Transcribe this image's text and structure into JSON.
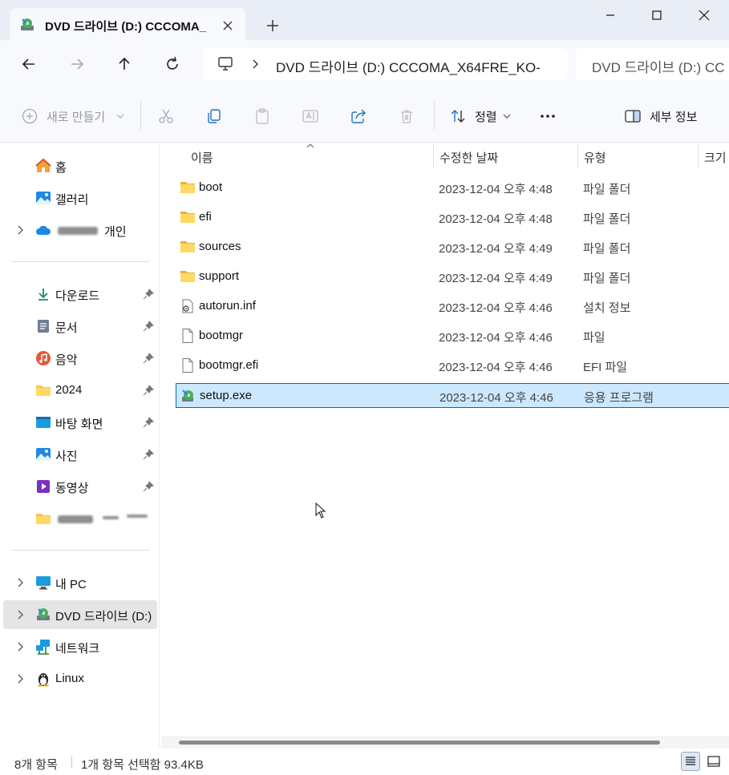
{
  "window": {
    "tab_title": "DVD 드라이브 (D:) CCCOMA_",
    "controls": [
      "minimize",
      "maximize",
      "close"
    ]
  },
  "address": {
    "path": "DVD 드라이브 (D:) CCCOMA_X64FRE_KO-",
    "search_placeholder": "DVD 드라이브 (D:) CC"
  },
  "toolbar": {
    "new_label": "새로 만들기",
    "sort_label": "정렬",
    "details_label": "세부 정보"
  },
  "sidebar": {
    "home": "홈",
    "gallery": "갤러리",
    "onedrive": "개인",
    "quick": [
      {
        "label": "다운로드",
        "icon": "download-icon"
      },
      {
        "label": "문서",
        "icon": "document-icon"
      },
      {
        "label": "음악",
        "icon": "music-icon"
      },
      {
        "label": "2024",
        "icon": "folder-icon"
      },
      {
        "label": "바탕 화면",
        "icon": "desktop-icon"
      },
      {
        "label": "사진",
        "icon": "photo-icon"
      },
      {
        "label": "동영상",
        "icon": "video-icon"
      },
      {
        "label": "",
        "icon": "folder-icon"
      }
    ],
    "this_pc": "내 PC",
    "dvd": "DVD 드라이브 (D:)",
    "network": "네트워크",
    "linux": "Linux"
  },
  "columns": {
    "name": "이름",
    "modified": "수정한 날짜",
    "type": "유형",
    "size": "크기"
  },
  "files": [
    {
      "name": "boot",
      "modified": "2023-12-04 오후 4:48",
      "type": "파일 폴더",
      "icon": "folder-icon"
    },
    {
      "name": "efi",
      "modified": "2023-12-04 오후 4:48",
      "type": "파일 폴더",
      "icon": "folder-icon"
    },
    {
      "name": "sources",
      "modified": "2023-12-04 오후 4:49",
      "type": "파일 폴더",
      "icon": "folder-icon"
    },
    {
      "name": "support",
      "modified": "2023-12-04 오후 4:49",
      "type": "파일 폴더",
      "icon": "folder-icon"
    },
    {
      "name": "autorun.inf",
      "modified": "2023-12-04 오후 4:46",
      "type": "설치 정보",
      "icon": "settings-file-icon"
    },
    {
      "name": "bootmgr",
      "modified": "2023-12-04 오후 4:46",
      "type": "파일",
      "icon": "file-icon"
    },
    {
      "name": "bootmgr.efi",
      "modified": "2023-12-04 오후 4:46",
      "type": "EFI 파일",
      "icon": "file-icon"
    },
    {
      "name": "setup.exe",
      "modified": "2023-12-04 오후 4:46",
      "type": "응용 프로그램",
      "icon": "setup-app-icon"
    }
  ],
  "status": {
    "count": "8개 항목",
    "selection": "1개 항목 선택함 93.4KB"
  },
  "colors": {
    "accent": "#0067c0",
    "selection_bg": "#cce8ff",
    "folder": "#f5c542",
    "chrome_bg": "#e9eef6"
  }
}
